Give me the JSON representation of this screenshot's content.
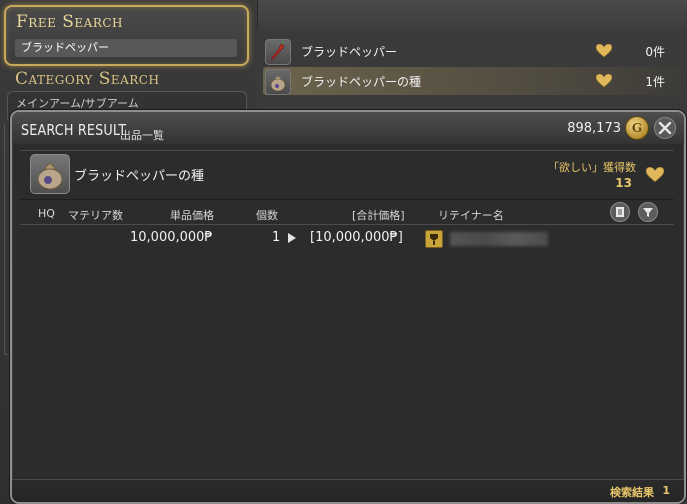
{
  "free_search": {
    "title": "Free Search",
    "query": "ブラッドペッパー"
  },
  "category_search": {
    "title": "Category Search",
    "first_item": "メインアーム/サブアーム"
  },
  "item_list": [
    {
      "name": "ブラッドペッパー",
      "count": "0件",
      "selected": false,
      "icon": "red-pepper-icon"
    },
    {
      "name": "ブラッドペッパーの種",
      "count": "1件",
      "selected": true,
      "icon": "seed-pouch-icon"
    }
  ],
  "window": {
    "title": "SEARCH RESULT",
    "subtitle": "出品一覧",
    "gil": "898,173",
    "gil_symbol": "G"
  },
  "item_detail": {
    "name": "ブラッドペッパーの種",
    "wish_label": "「欲しい」獲得数",
    "wish_count": "13"
  },
  "columns": {
    "hq": "HQ",
    "materia": "マテリア数",
    "unit_price": "単品価格",
    "quantity": "個数",
    "total": "[合計価格]",
    "retainer": "リテイナー名"
  },
  "results": [
    {
      "unit_price": "10,000,000₱",
      "quantity": "1",
      "total": "[10,000,000₱]"
    }
  ],
  "footer": {
    "label": "検索結果",
    "count": "1"
  },
  "colors": {
    "accent_gold": "#e8c66a",
    "heart": "#e0b85c",
    "panel_bg": "#2c2c2c"
  }
}
